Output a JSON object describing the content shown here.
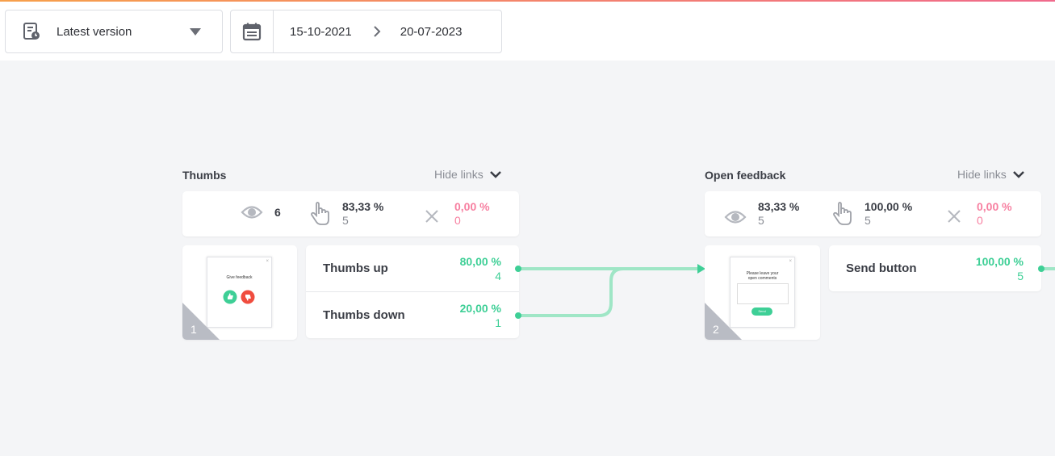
{
  "toolbar": {
    "version_label": "Latest version",
    "date_from": "15-10-2021",
    "date_to": "20-07-2023"
  },
  "steps": [
    {
      "title": "Thumbs",
      "hide_links": "Hide links",
      "stats": {
        "views": "6",
        "interactions_pct": "83,33 %",
        "interactions_count": "5",
        "closed_pct": "0,00 %",
        "closed_count": "0"
      },
      "preview_title": "Give feedback",
      "number": "1",
      "options": [
        {
          "label": "Thumbs up",
          "pct": "80,00 %",
          "count": "4"
        },
        {
          "label": "Thumbs down",
          "pct": "20,00 %",
          "count": "1"
        }
      ]
    },
    {
      "title": "Open feedback",
      "hide_links": "Hide links",
      "stats": {
        "views_pct": "83,33 %",
        "views_count": "5",
        "interactions_pct": "100,00 %",
        "interactions_count": "5",
        "closed_pct": "0,00 %",
        "closed_count": "0"
      },
      "preview_title": "Please leave your open comments",
      "preview_button": "Send",
      "number": "2",
      "options": [
        {
          "label": "Send button",
          "pct": "100,00 %",
          "count": "5"
        }
      ]
    }
  ],
  "icons": [
    "version-icon",
    "caret-down-icon",
    "calendar-icon",
    "chevron-right-icon",
    "chevron-down-icon",
    "eye-icon",
    "hand-pointer-icon",
    "close-x-icon",
    "thumbs-up-icon",
    "thumbs-down-icon"
  ],
  "colors": {
    "accent": "#3ecf96",
    "pink": "#f77fa0",
    "background": "#f4f5f7"
  }
}
